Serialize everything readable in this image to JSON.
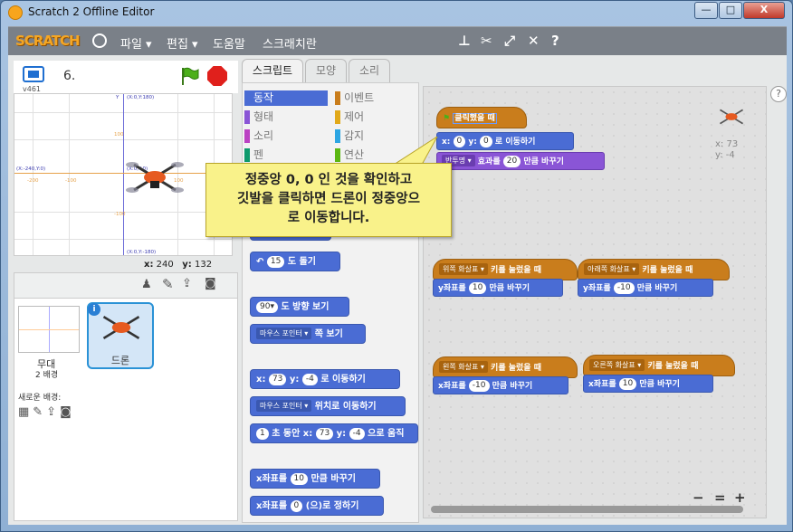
{
  "window": {
    "title": "Scratch 2 Offline Editor",
    "min": "—",
    "max": "□",
    "close": "X"
  },
  "menubar": {
    "logo": "SCRATCH",
    "items": [
      "파일 ▾",
      "편집 ▾",
      "도움말",
      "스크래치란"
    ]
  },
  "stage": {
    "version": "v461",
    "project_name": "6.",
    "coords": {
      "top_label": "(X:0,Y:180)",
      "left_label": "(X:-240,Y:0)",
      "center_label": "(X:0,Y:0)",
      "bottom_label": "(X:0,Y:-180)",
      "y_axis": "Y",
      "ticks_v": [
        "100",
        "-100"
      ],
      "ticks_h": [
        "-200",
        "-100",
        "100",
        "200"
      ]
    },
    "mouse_x_label": "x:",
    "mouse_x": "240",
    "mouse_y_label": "y:",
    "mouse_y": "132"
  },
  "sprites": {
    "stage_label": "무대",
    "stage_sub": "2 배경",
    "new_backdrop": "새로운 배경:",
    "sprite_name": "드론",
    "info": "i"
  },
  "tabs": [
    "스크립트",
    "모양",
    "소리"
  ],
  "categories": {
    "left": [
      "동작",
      "형태",
      "소리",
      "펜"
    ],
    "right": [
      "이벤트",
      "제어",
      "감지",
      "연산"
    ],
    "colors_left": [
      "#4a6cd4",
      "#8a55d6",
      "#bb42c3",
      "#0e9a6c"
    ],
    "colors_right": [
      "#c97d1c",
      "#e1a91a",
      "#2ca5e2",
      "#5cb712"
    ]
  },
  "palette": {
    "turn_left": {
      "label": "도 돌기",
      "value": "15"
    },
    "point_dir": {
      "label": "도 방향 보기",
      "value": "90▾"
    },
    "point_towards": {
      "dd": "마우스 포인터 ▾",
      "label": "쪽 보기"
    },
    "goto_xy": {
      "x_label": "x:",
      "x": "73",
      "y_label": "y:",
      "y": "-4",
      "label": "로 이동하기"
    },
    "goto": {
      "dd": "마우스 포인터 ▾",
      "label": "위치로 이동하기"
    },
    "glide": {
      "secs": "1",
      "label1": "초 동안 x:",
      "x": "73",
      "y_label": "y:",
      "y": "-4",
      "label2": "으로 움직"
    },
    "change_x": {
      "label1": "x좌표를",
      "value": "10",
      "label2": "만큼 바꾸기"
    },
    "set_x": {
      "label1": "x좌표를",
      "value": "0",
      "label2": "(으)로 정하기"
    }
  },
  "scripts": {
    "flag_hat": "클릭했을 때",
    "goto": {
      "x_label": "x:",
      "x": "0",
      "y_label": "y:",
      "y": "0",
      "label": "로 이동하기"
    },
    "effect": {
      "dd": "반투명 ▾",
      "label1": "효과를",
      "value": "20",
      "label2": "만큼 바꾸기"
    },
    "key_up": {
      "dd": "위쪽 화살표 ▾",
      "label": "키를 눌렀을 때",
      "body1": "y좌표를",
      "value": "10",
      "body2": "만큼 바꾸기"
    },
    "key_down": {
      "dd": "아래쪽 화살표 ▾",
      "label": "키를 눌렀을 때",
      "body1": "y좌표를",
      "value": "-10",
      "body2": "만큼 바꾸기"
    },
    "key_left": {
      "dd": "왼쪽 화살표 ▾",
      "label": "키를 눌렀을 때",
      "body1": "x좌표를",
      "value": "-10",
      "body2": "만큼 바꾸기"
    },
    "key_right": {
      "dd": "오른쪽 화살표 ▾",
      "label": "키를 눌렀을 때",
      "body1": "x좌표를",
      "value": "10",
      "body2": "만큼 바꾸기"
    },
    "sprite_x": "x: 73",
    "sprite_y": "y: -4"
  },
  "callout": {
    "line1": "정중앙 0, 0 인 것을 확인하고",
    "line2": "깃발을 클릭하면 드론이 정중앙으",
    "line3": "로 이동합니다."
  },
  "zoom": {
    "out": "−",
    "reset": "=",
    "in": "+"
  },
  "help": "?"
}
